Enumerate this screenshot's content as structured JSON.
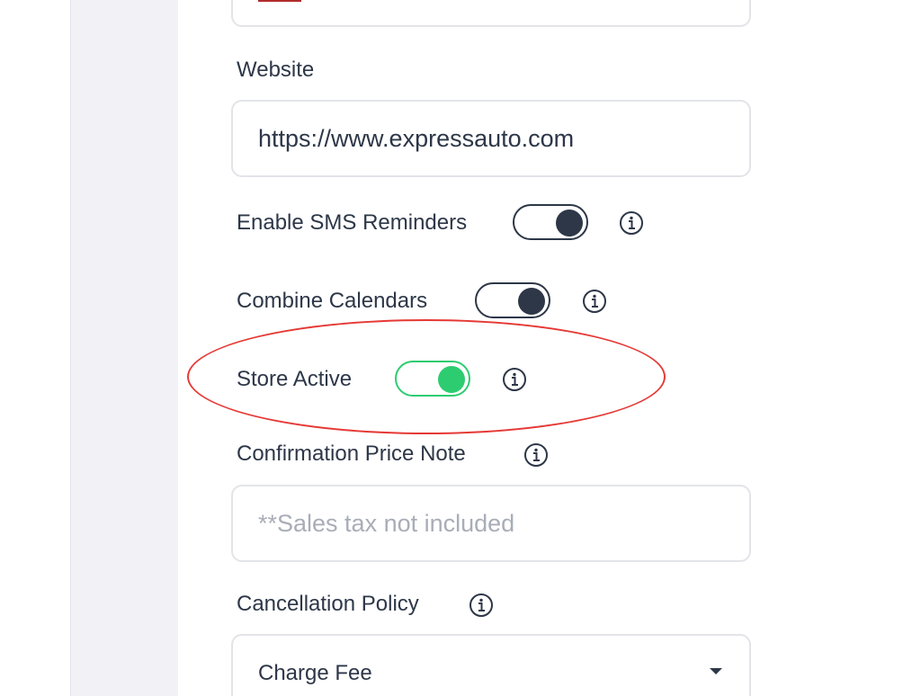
{
  "top_field": {
    "flag_color": "#d43b3b"
  },
  "website": {
    "label": "Website",
    "value": "https://www.expressauto.com"
  },
  "sms_reminders": {
    "label": "Enable SMS Reminders",
    "enabled": true,
    "info_icon": "info-icon"
  },
  "combine_calendars": {
    "label": "Combine Calendars",
    "enabled": true,
    "info_icon": "info-icon"
  },
  "store_active": {
    "label": "Store Active",
    "enabled": true,
    "accent": "#2ecc71",
    "info_icon": "info-icon"
  },
  "confirmation_price_note": {
    "label": "Confirmation Price Note",
    "placeholder": "**Sales tax not included",
    "info_icon": "info-icon"
  },
  "cancellation_policy": {
    "label": "Cancellation Policy",
    "selected": "Charge Fee",
    "info_icon": "info-icon",
    "dropdown_icon": "caret-down-icon"
  },
  "annotation": {
    "highlight_color": "#e53935"
  }
}
